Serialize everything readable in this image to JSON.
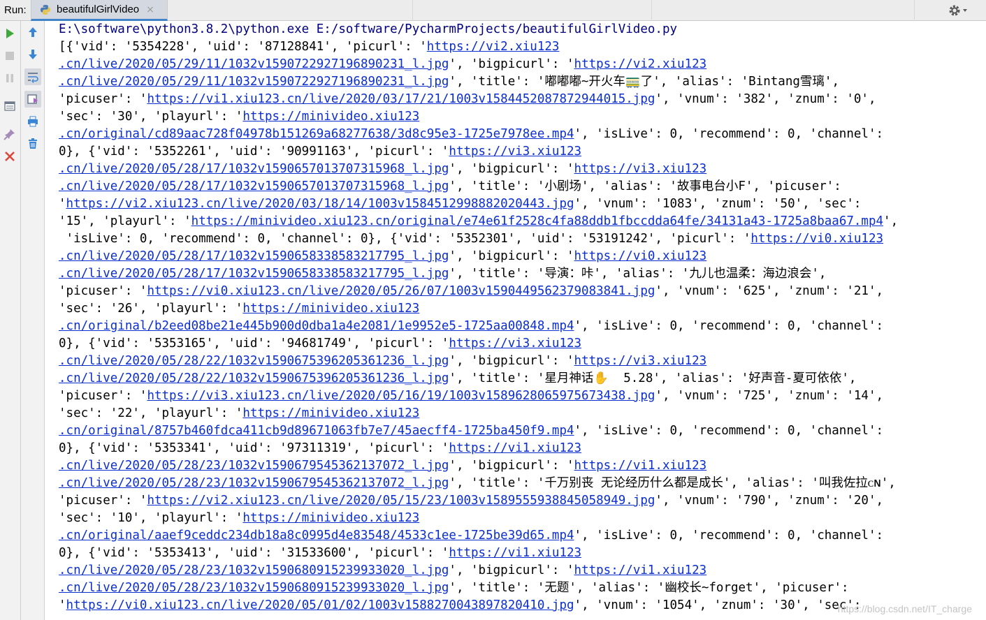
{
  "header": {
    "run_label": "Run:",
    "tab_label": "beautifulGirlVideo",
    "tab_close": "×"
  },
  "console": {
    "command": "E:\\software\\python3.8.2\\python.exe E:/software/PycharmProjects/beautifulGirlVideo.py",
    "lines": [
      [
        {
          "t": "[{'vid': '5354228', 'uid': '87128841', 'picurl': '"
        },
        {
          "t": "https://vi2.xiu123",
          "u": true
        }
      ],
      [
        {
          "t": ".cn/live/2020/05/29/11/1032v1590722927196890231_l.jpg",
          "u": true
        },
        {
          "t": "', 'bigpicurl': '"
        },
        {
          "t": "https://vi2.xiu123",
          "u": true
        }
      ],
      [
        {
          "t": ".cn/live/2020/05/29/11/1032v1590722927196890231_l.jpg",
          "u": true
        },
        {
          "t": "', 'title': '嘟嘟嘟~开火车🚃了', 'alias': 'Bintang雪璃',"
        }
      ],
      [
        {
          "t": "'picuser': '"
        },
        {
          "t": "https://vi1.xiu123.cn/live/2020/03/17/21/1003v1584452087872944015.jpg",
          "u": true
        },
        {
          "t": "', 'vnum': '382', 'znum': '0',"
        }
      ],
      [
        {
          "t": "'sec': '30', 'playurl': '"
        },
        {
          "t": "https://minivideo.xiu123",
          "u": true
        }
      ],
      [
        {
          "t": ".cn/original/cd89aac728f04978b151269a68277638/3d8c95e3-1725e7978ee.mp4",
          "u": true
        },
        {
          "t": "', 'isLive': 0, 'recommend': 0, 'channel':"
        }
      ],
      [
        {
          "t": "0}, {'vid': '5352261', 'uid': '90991163', 'picurl': '"
        },
        {
          "t": "https://vi3.xiu123",
          "u": true
        }
      ],
      [
        {
          "t": ".cn/live/2020/05/28/17/1032v1590657013707315968_l.jpg",
          "u": true
        },
        {
          "t": "', 'bigpicurl': '"
        },
        {
          "t": "https://vi3.xiu123",
          "u": true
        }
      ],
      [
        {
          "t": ".cn/live/2020/05/28/17/1032v1590657013707315968_l.jpg",
          "u": true
        },
        {
          "t": "', 'title': '小剧场', 'alias': '故事电台小F', 'picuser':"
        }
      ],
      [
        {
          "t": "'"
        },
        {
          "t": "https://vi2.xiu123.cn/live/2020/03/18/14/1003v1584512998882020443.jpg",
          "u": true
        },
        {
          "t": "', 'vnum': '1083', 'znum': '50', 'sec':"
        }
      ],
      [
        {
          "t": "'15', 'playurl': '"
        },
        {
          "t": "https://minivideo.xiu123.cn/original/e74e61f2528c4fa88ddb1fbccdda64fe/34131a43-1725a8baa67.mp4",
          "u": true
        },
        {
          "t": "',"
        }
      ],
      [
        {
          "t": " 'isLive': 0, 'recommend': 0, 'channel': 0}, {'vid': '5352301', 'uid': '53191242', 'picurl': '"
        },
        {
          "t": "https://vi0.xiu123",
          "u": true
        }
      ],
      [
        {
          "t": ".cn/live/2020/05/28/17/1032v1590658338583217795_l.jpg",
          "u": true
        },
        {
          "t": "', 'bigpicurl': '"
        },
        {
          "t": "https://vi0.xiu123",
          "u": true
        }
      ],
      [
        {
          "t": ".cn/live/2020/05/28/17/1032v1590658338583217795_l.jpg",
          "u": true
        },
        {
          "t": "', 'title': '导演：咔', 'alias': '九儿也温柔：海边浪会',"
        }
      ],
      [
        {
          "t": "'picuser': '"
        },
        {
          "t": "https://vi0.xiu123.cn/live/2020/05/26/07/1003v1590449562379083841.jpg",
          "u": true
        },
        {
          "t": "', 'vnum': '625', 'znum': '21',"
        }
      ],
      [
        {
          "t": "'sec': '26', 'playurl': '"
        },
        {
          "t": "https://minivideo.xiu123",
          "u": true
        }
      ],
      [
        {
          "t": ".cn/original/b2eed08be21e445b900d0dba1a4e2081/1e9952e5-1725aa00848.mp4",
          "u": true
        },
        {
          "t": "', 'isLive': 0, 'recommend': 0, 'channel':"
        }
      ],
      [
        {
          "t": "0}, {'vid': '5353165', 'uid': '94681749', 'picurl': '"
        },
        {
          "t": "https://vi3.xiu123",
          "u": true
        }
      ],
      [
        {
          "t": ".cn/live/2020/05/28/22/1032v1590675396205361236_l.jpg",
          "u": true
        },
        {
          "t": "', 'bigpicurl': '"
        },
        {
          "t": "https://vi3.xiu123",
          "u": true
        }
      ],
      [
        {
          "t": ".cn/live/2020/05/28/22/1032v1590675396205361236_l.jpg",
          "u": true
        },
        {
          "t": "', 'title': '星月神话✋  5.28', 'alias': '好声音-夏可依依',"
        }
      ],
      [
        {
          "t": "'picuser': '"
        },
        {
          "t": "https://vi3.xiu123.cn/live/2020/05/16/19/1003v1589628065975673438.jpg",
          "u": true
        },
        {
          "t": "', 'vnum': '725', 'znum': '14',"
        }
      ],
      [
        {
          "t": "'sec': '22', 'playurl': '"
        },
        {
          "t": "https://minivideo.xiu123",
          "u": true
        }
      ],
      [
        {
          "t": ".cn/original/8757b460fdca411cb9d89671063fb7e7/45aecff4-1725ba450f9.mp4",
          "u": true
        },
        {
          "t": "', 'isLive': 0, 'recommend': 0, 'channel':"
        }
      ],
      [
        {
          "t": "0}, {'vid': '5353341', 'uid': '97311319', 'picurl': '"
        },
        {
          "t": "https://vi1.xiu123",
          "u": true
        }
      ],
      [
        {
          "t": ".cn/live/2020/05/28/23/1032v1590679545362137072_l.jpg",
          "u": true
        },
        {
          "t": "', 'bigpicurl': '"
        },
        {
          "t": "https://vi1.xiu123",
          "u": true
        }
      ],
      [
        {
          "t": ".cn/live/2020/05/28/23/1032v1590679545362137072_l.jpg",
          "u": true
        },
        {
          "t": "', 'title': '千万别丧 无论经历什么都是成长', 'alias': '叫我佐拉ᴄɴ',"
        }
      ],
      [
        {
          "t": "'picuser': '"
        },
        {
          "t": "https://vi2.xiu123.cn/live/2020/05/15/23/1003v1589555938845058949.jpg",
          "u": true
        },
        {
          "t": "', 'vnum': '790', 'znum': '20',"
        }
      ],
      [
        {
          "t": "'sec': '10', 'playurl': '"
        },
        {
          "t": "https://minivideo.xiu123",
          "u": true
        }
      ],
      [
        {
          "t": ".cn/original/aaef9ceddc234db18a8c0995d4e83548/4533c1ee-1725be39d65.mp4",
          "u": true
        },
        {
          "t": "', 'isLive': 0, 'recommend': 0, 'channel':"
        }
      ],
      [
        {
          "t": "0}, {'vid': '5353413', 'uid': '31533600', 'picurl': '"
        },
        {
          "t": "https://vi1.xiu123",
          "u": true
        }
      ],
      [
        {
          "t": ".cn/live/2020/05/28/23/1032v1590680915239933020_l.jpg",
          "u": true
        },
        {
          "t": "', 'bigpicurl': '"
        },
        {
          "t": "https://vi1.xiu123",
          "u": true
        }
      ],
      [
        {
          "t": ".cn/live/2020/05/28/23/1032v1590680915239933020_l.jpg",
          "u": true
        },
        {
          "t": "', 'title': '无题', 'alias': '幽校长~forget', 'picuser':"
        }
      ],
      [
        {
          "t": "'"
        },
        {
          "t": "https://vi0.xiu123.cn/live/2020/05/01/02/1003v1588270043897820410.jpg",
          "u": true
        },
        {
          "t": "', 'vnum': '1054', 'znum': '30', 'sec':"
        }
      ]
    ]
  },
  "watermark": "https://blog.csdn.net/IT_charge",
  "colors": {
    "link": "#0b2ed0",
    "command": "#000080",
    "run_green": "#3fa93b",
    "stop_red": "#d9473c",
    "arrow_blue": "#3b86d4"
  }
}
